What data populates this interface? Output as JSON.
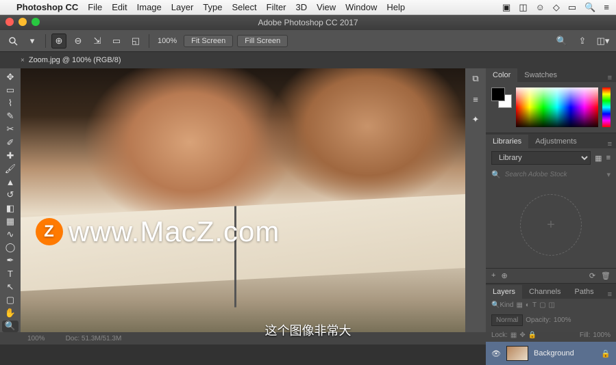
{
  "mac_menu": {
    "app": "Photoshop CC",
    "items": [
      "File",
      "Edit",
      "Image",
      "Layer",
      "Type",
      "Select",
      "Filter",
      "3D",
      "View",
      "Window",
      "Help"
    ]
  },
  "window_title": "Adobe Photoshop CC 2017",
  "options_bar": {
    "zoom_level": "100%",
    "fit_screen": "Fit Screen",
    "fill_screen": "Fill Screen"
  },
  "doc_tab": {
    "close": "×",
    "label": "Zoom.jpg @ 100% (RGB/8)"
  },
  "watermark": {
    "badge": "Z",
    "text": "www.MacZ.com"
  },
  "color_panel": {
    "tabs": [
      "Color",
      "Swatches"
    ]
  },
  "libraries_panel": {
    "tabs": [
      "Libraries",
      "Adjustments"
    ],
    "selector": "Library",
    "search_placeholder": "Search Adobe Stock"
  },
  "libraries_footer_plus": "+",
  "layers_panel": {
    "tabs": [
      "Layers",
      "Channels",
      "Paths"
    ],
    "kind": "Kind",
    "blend": "Normal",
    "opacity_label": "Opacity:",
    "opacity_val": "100%",
    "lock_label": "Lock:",
    "fill_label": "Fill:",
    "fill_val": "100%",
    "layer_name": "Background"
  },
  "status": {
    "zoom": "100%",
    "doc": "Doc: 51.3M/51.3M"
  },
  "subtitle": "这个图像非常大"
}
